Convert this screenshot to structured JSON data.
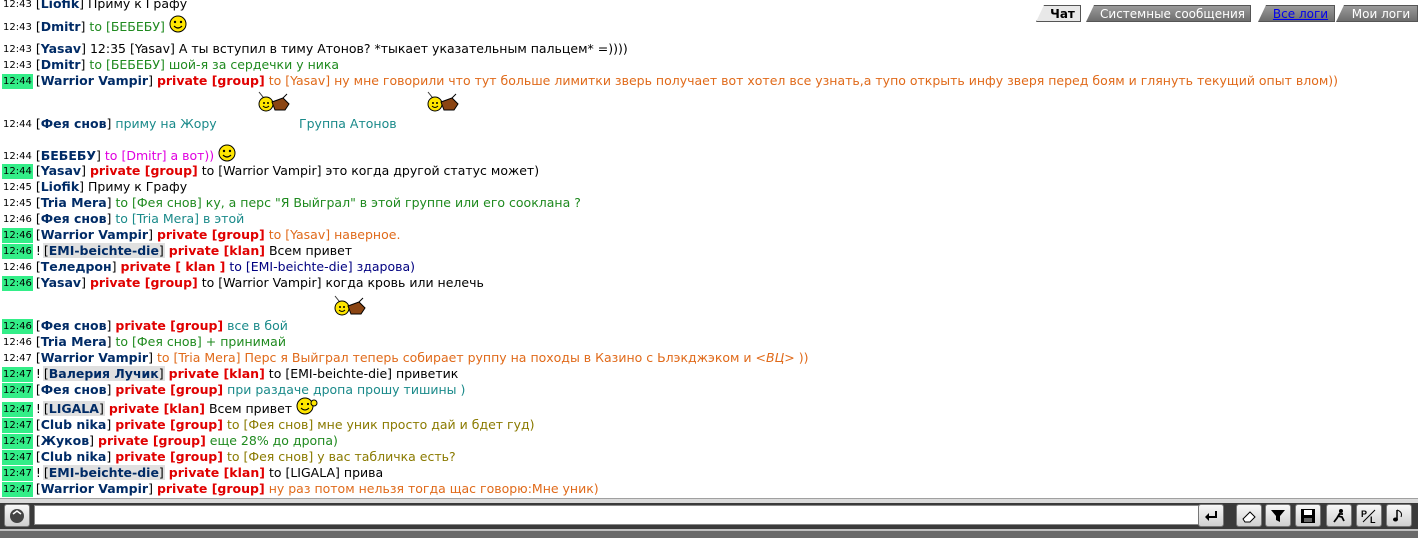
{
  "tabs": [
    {
      "label": "Чат",
      "state": "active"
    },
    {
      "label": "Системные сообщения",
      "state": "normal"
    },
    {
      "label": "Все логи",
      "state": "link"
    },
    {
      "label": "Мои логи",
      "state": "normal"
    }
  ],
  "colors": {
    "timestamp_highlight": "#33ee88",
    "nick": "#002b66",
    "private": "#e00000",
    "green_text": "#1f8a1f",
    "orange_text": "#e06a1a",
    "teal_text": "#1a8a8a",
    "olive_text": "#8a7a00",
    "magenta_text": "#e000e0",
    "navy_text": "#000080"
  },
  "messages": [
    {
      "time": "12:43",
      "hl": false,
      "nick": "Liofik",
      "text": "Приму к Графу",
      "color": "#000000"
    },
    {
      "time": "12:43",
      "hl": false,
      "nick": "Dmitr",
      "to": "[БЕБЕБУ]",
      "text": "",
      "color": "#1f8a1f",
      "smileys": [
        "smile"
      ]
    },
    {
      "time": "12:43",
      "hl": false,
      "nick": "Yasav",
      "text": "12:35 [Yasav] А ты вступил в тиму Атонов? *тыкает указательным пальцем* =))))",
      "color": "#000000"
    },
    {
      "time": "12:43",
      "hl": false,
      "nick": "Dmitr",
      "to": "[БЕБЕБУ]",
      "text": "шой-я за сердечки у ника",
      "color": "#1f8a1f"
    },
    {
      "time": "12:44",
      "hl": true,
      "nick": "Warrior Vampir",
      "priv": "private [group]",
      "to": "[Yasav]",
      "text": "ну мне говорили что тут больше лимитки зверь получает вот хотел все узнать,а тупо открыть инфу зверя перед боям и глянуть текущий опыт влом))",
      "color": "#e06a1a"
    },
    {
      "time": "12:44",
      "hl": false,
      "nick": "Фея снов",
      "text": "приму на Жору",
      "text2": "Группа Атонов",
      "color": "#1a8a8a",
      "smileys": [
        "rider",
        "rider"
      ]
    },
    {
      "time": "12:44",
      "hl": false,
      "nick": "БЕБЕБУ",
      "to": "[Dmitr]",
      "text": "а вот))",
      "color": "#e000e0",
      "smileys": [
        "smile"
      ]
    },
    {
      "time": "12:44",
      "hl": true,
      "nick": "Yasav",
      "priv": "private [group]",
      "to": "[Warrior Vampir]",
      "text": "это когда другой статус может)",
      "color": "#000000"
    },
    {
      "time": "12:45",
      "hl": false,
      "nick": "Liofik",
      "text": "Приму к Графу",
      "color": "#000000"
    },
    {
      "time": "12:45",
      "hl": false,
      "nick": "Tria Mera",
      "to": "[Фея снов]",
      "text": "ку, а перс \"Я Выйграл\" в этой группе или его сооклана ?",
      "color": "#1f8a1f"
    },
    {
      "time": "12:46",
      "hl": false,
      "nick": "Фея снов",
      "to": "[Tria Mera]",
      "text": "в этой",
      "color": "#1a8a8a"
    },
    {
      "time": "12:46",
      "hl": true,
      "nick": "Warrior Vampir",
      "priv": "private [group]",
      "to": "[Yasav]",
      "text": "наверное.",
      "color": "#e06a1a"
    },
    {
      "time": "12:46",
      "hl": true,
      "excl": true,
      "nick": "EMI-beichte-die",
      "nickhl": true,
      "priv": "private [klan]",
      "text": "Всем привет",
      "color": "#000000"
    },
    {
      "time": "12:46",
      "hl": false,
      "nick": "Теледрон",
      "priv": "private [ klan ]",
      "to": "[EMI-beichte-die]",
      "text": "здарова)",
      "color": "#000080"
    },
    {
      "time": "12:46",
      "hl": true,
      "nick": "Yasav",
      "priv": "private [group]",
      "to": "[Warrior Vampir]",
      "text": "когда кровь или нелечь",
      "color": "#000000"
    },
    {
      "time": "12:46",
      "hl": true,
      "nick": "Фея снов",
      "priv": "private [group]",
      "text": "все в бой",
      "color": "#1a8a8a",
      "smileys": [
        "rider"
      ]
    },
    {
      "time": "12:46",
      "hl": false,
      "nick": "Tria Mera",
      "to": "[Фея снов]",
      "text": "+ принимай",
      "color": "#1f8a1f"
    },
    {
      "time": "12:47",
      "hl": false,
      "nick": "Warrior Vampir",
      "to": "[Tria Mera]",
      "text": "Перс я Выйграл теперь собирает руппу на походы в Казино с Ьлэкджэком и ",
      "text_italic": "<ВЦ>",
      "text_end": " ))",
      "color": "#e06a1a"
    },
    {
      "time": "12:47",
      "hl": true,
      "excl": true,
      "nick": "Валерия Лучик",
      "nickhl": true,
      "priv": "private [klan]",
      "to": "[EMI-beichte-die]",
      "text": "приветик",
      "color": "#000000"
    },
    {
      "time": "12:47",
      "hl": true,
      "nick": "Фея снов",
      "priv": "private [group]",
      "text": "при раздаче дропа прошу тишины )",
      "color": "#1a8a8a"
    },
    {
      "time": "12:47",
      "hl": true,
      "excl": true,
      "nick": "LIGALA",
      "nickhl": true,
      "priv": "private [klan]",
      "text": "Всем привет",
      "color": "#000000",
      "smileys": [
        "wave"
      ]
    },
    {
      "time": "12:47",
      "hl": true,
      "nick": "Club nika",
      "priv": "private [group]",
      "to": "[Фея снов]",
      "text": "мне уник просто дай и бдет гуд)",
      "color": "#8a7a00"
    },
    {
      "time": "12:47",
      "hl": true,
      "nick": "Жуков",
      "priv": "private [group]",
      "text": "еще 28% до дропа)",
      "color": "#1f8a1f"
    },
    {
      "time": "12:47",
      "hl": true,
      "nick": "Club nika",
      "priv": "private [group]",
      "to": "[Фея снов]",
      "text": "у вас табличка есть?",
      "color": "#8a7a00"
    },
    {
      "time": "12:47",
      "hl": true,
      "excl": true,
      "nick": "EMI-beichte-die",
      "nickhl": true,
      "priv": "private [klan]",
      "to": "[LIGALA]",
      "text": "прива",
      "color": "#000000"
    },
    {
      "time": "12:47",
      "hl": true,
      "nick": "Warrior Vampir",
      "priv": "private [group]",
      "text": "ну раз потом нельзя тогда щас говорю:Мне уник)",
      "color": "#e06a1a"
    }
  ],
  "input": {
    "value": "",
    "placeholder": ""
  },
  "toolbar": [
    {
      "icon": "enter-arrow-icon"
    },
    {
      "icon": "eraser-icon"
    },
    {
      "icon": "filter-icon"
    },
    {
      "icon": "save-disk-icon"
    },
    {
      "icon": "running-man-icon"
    },
    {
      "icon": "pl-translit-icon"
    },
    {
      "icon": "music-note-icon"
    }
  ]
}
